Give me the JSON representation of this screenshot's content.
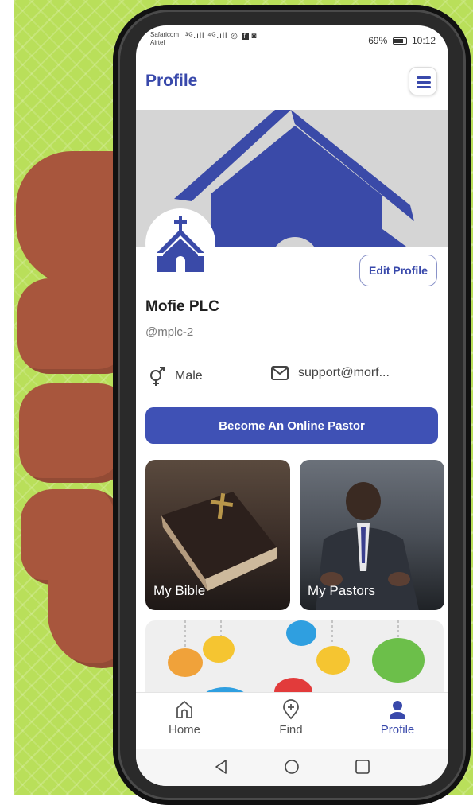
{
  "status_bar": {
    "carrier_1": "Safaricom",
    "carrier_2": "Airtel",
    "signal_text": "³ᴳ.ıll ⁴ᴳ.ıll",
    "battery": "69%",
    "time": "10:12"
  },
  "header": {
    "title": "Profile"
  },
  "profile": {
    "edit_label": "Edit Profile",
    "name": "Mofie PLC",
    "handle": "@mplc-2",
    "gender": "Male",
    "email": "support@morf..."
  },
  "cta": {
    "label": "Become An Online Pastor"
  },
  "cards": [
    {
      "label": "My Bible"
    },
    {
      "label": "My Pastors"
    }
  ],
  "tabs": [
    {
      "label": "Home",
      "icon": "home-icon",
      "active": false
    },
    {
      "label": "Find",
      "icon": "location-plus-icon",
      "active": false
    },
    {
      "label": "Profile",
      "icon": "person-icon",
      "active": true
    }
  ],
  "colors": {
    "accent": "#3949ab",
    "button": "#3f51b5",
    "background": "#b9df5a"
  }
}
